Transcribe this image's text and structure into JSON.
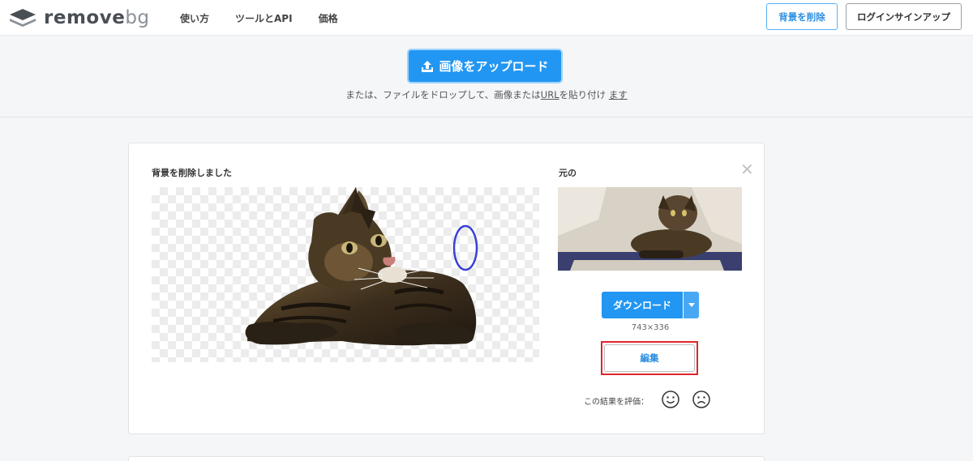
{
  "header": {
    "logo": {
      "brand_main": "remove",
      "brand_suffix": "bg",
      "icon": "layers-logo-icon"
    },
    "nav": [
      {
        "label": "使い方"
      },
      {
        "label": "ツールとAPI"
      },
      {
        "label": "価格"
      }
    ],
    "remove_bg_button": "背景を削除",
    "login_button": "ログインサインアップ"
  },
  "upload": {
    "button_label": "画像をアップロード",
    "button_icon": "upload-icon",
    "hint_prefix": "または、ファイルをドロップして、画像または",
    "hint_url": "URL",
    "hint_mid": "を貼り付け ",
    "hint_suffix": "ます"
  },
  "result": {
    "title": "背景を削除しました",
    "original_title": "元の",
    "close_icon": "close-icon",
    "download_button": "ダウンロード",
    "size": "743×336",
    "edit_button": "編集",
    "rate_label": "この結果を評価：",
    "rate_icons": [
      "smile-icon",
      "frown-icon"
    ]
  },
  "colors": {
    "accent": "#2196f3",
    "highlight": "#e0242c",
    "annotation": "#3a3fd4"
  }
}
